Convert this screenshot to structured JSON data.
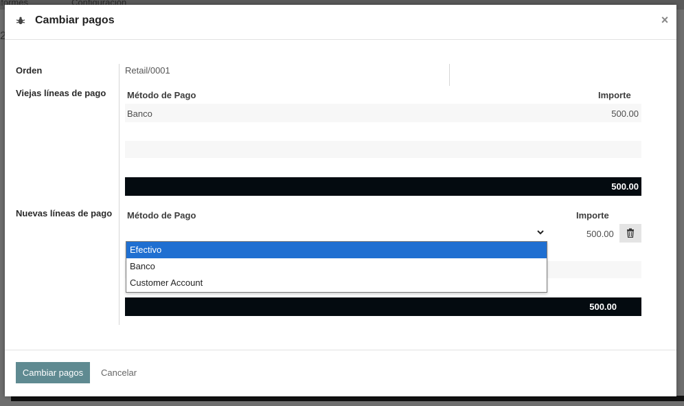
{
  "background": {
    "menu": [
      "nformes",
      "Configuración"
    ],
    "partial_text": "2"
  },
  "modal": {
    "title": "Cambiar pagos",
    "close_glyph": "×"
  },
  "order": {
    "label": "Orden",
    "value": "Retail/0001"
  },
  "old_lines": {
    "label": "Viejas líneas de pago",
    "columns": [
      "Método de Pago",
      "Importe"
    ],
    "rows": [
      {
        "method": "Banco",
        "amount": "500.00"
      }
    ],
    "total": "500.00"
  },
  "new_lines": {
    "label": "Nuevas líneas de pago",
    "columns": [
      "Método de Pago",
      "Importe"
    ],
    "rows": [
      {
        "method": "",
        "amount": "500.00"
      }
    ],
    "total": "500.00",
    "dropdown_options": [
      "Efectivo",
      "Banco",
      "Customer Account"
    ],
    "dropdown_selected": "Efectivo"
  },
  "footer": {
    "confirm_label": "Cambiar pagos",
    "cancel_label": "Cancelar"
  },
  "colors": {
    "primary": "#5f8a91",
    "total_bar": "#040b10",
    "selection": "#1f6fd1"
  }
}
